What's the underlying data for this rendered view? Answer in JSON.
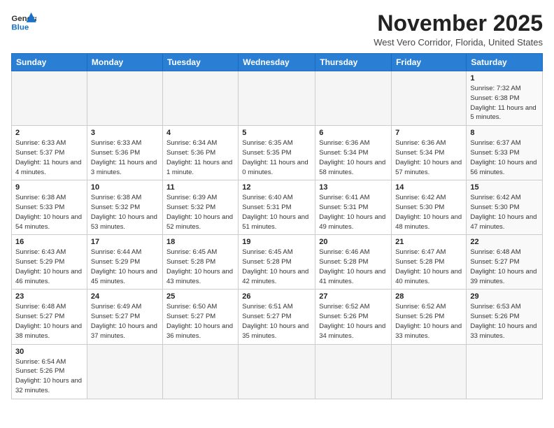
{
  "logo": {
    "line1": "General",
    "line2": "Blue"
  },
  "header": {
    "month": "November 2025",
    "location": "West Vero Corridor, Florida, United States"
  },
  "days_of_week": [
    "Sunday",
    "Monday",
    "Tuesday",
    "Wednesday",
    "Thursday",
    "Friday",
    "Saturday"
  ],
  "weeks": [
    [
      {
        "day": "",
        "info": ""
      },
      {
        "day": "",
        "info": ""
      },
      {
        "day": "",
        "info": ""
      },
      {
        "day": "",
        "info": ""
      },
      {
        "day": "",
        "info": ""
      },
      {
        "day": "",
        "info": ""
      },
      {
        "day": "1",
        "info": "Sunrise: 7:32 AM\nSunset: 6:38 PM\nDaylight: 11 hours and 5 minutes."
      }
    ],
    [
      {
        "day": "2",
        "info": "Sunrise: 6:33 AM\nSunset: 5:37 PM\nDaylight: 11 hours and 4 minutes."
      },
      {
        "day": "3",
        "info": "Sunrise: 6:33 AM\nSunset: 5:36 PM\nDaylight: 11 hours and 3 minutes."
      },
      {
        "day": "4",
        "info": "Sunrise: 6:34 AM\nSunset: 5:36 PM\nDaylight: 11 hours and 1 minute."
      },
      {
        "day": "5",
        "info": "Sunrise: 6:35 AM\nSunset: 5:35 PM\nDaylight: 11 hours and 0 minutes."
      },
      {
        "day": "6",
        "info": "Sunrise: 6:36 AM\nSunset: 5:34 PM\nDaylight: 10 hours and 58 minutes."
      },
      {
        "day": "7",
        "info": "Sunrise: 6:36 AM\nSunset: 5:34 PM\nDaylight: 10 hours and 57 minutes."
      },
      {
        "day": "8",
        "info": "Sunrise: 6:37 AM\nSunset: 5:33 PM\nDaylight: 10 hours and 56 minutes."
      }
    ],
    [
      {
        "day": "9",
        "info": "Sunrise: 6:38 AM\nSunset: 5:33 PM\nDaylight: 10 hours and 54 minutes."
      },
      {
        "day": "10",
        "info": "Sunrise: 6:38 AM\nSunset: 5:32 PM\nDaylight: 10 hours and 53 minutes."
      },
      {
        "day": "11",
        "info": "Sunrise: 6:39 AM\nSunset: 5:32 PM\nDaylight: 10 hours and 52 minutes."
      },
      {
        "day": "12",
        "info": "Sunrise: 6:40 AM\nSunset: 5:31 PM\nDaylight: 10 hours and 51 minutes."
      },
      {
        "day": "13",
        "info": "Sunrise: 6:41 AM\nSunset: 5:31 PM\nDaylight: 10 hours and 49 minutes."
      },
      {
        "day": "14",
        "info": "Sunrise: 6:42 AM\nSunset: 5:30 PM\nDaylight: 10 hours and 48 minutes."
      },
      {
        "day": "15",
        "info": "Sunrise: 6:42 AM\nSunset: 5:30 PM\nDaylight: 10 hours and 47 minutes."
      }
    ],
    [
      {
        "day": "16",
        "info": "Sunrise: 6:43 AM\nSunset: 5:29 PM\nDaylight: 10 hours and 46 minutes."
      },
      {
        "day": "17",
        "info": "Sunrise: 6:44 AM\nSunset: 5:29 PM\nDaylight: 10 hours and 45 minutes."
      },
      {
        "day": "18",
        "info": "Sunrise: 6:45 AM\nSunset: 5:28 PM\nDaylight: 10 hours and 43 minutes."
      },
      {
        "day": "19",
        "info": "Sunrise: 6:45 AM\nSunset: 5:28 PM\nDaylight: 10 hours and 42 minutes."
      },
      {
        "day": "20",
        "info": "Sunrise: 6:46 AM\nSunset: 5:28 PM\nDaylight: 10 hours and 41 minutes."
      },
      {
        "day": "21",
        "info": "Sunrise: 6:47 AM\nSunset: 5:28 PM\nDaylight: 10 hours and 40 minutes."
      },
      {
        "day": "22",
        "info": "Sunrise: 6:48 AM\nSunset: 5:27 PM\nDaylight: 10 hours and 39 minutes."
      }
    ],
    [
      {
        "day": "23",
        "info": "Sunrise: 6:48 AM\nSunset: 5:27 PM\nDaylight: 10 hours and 38 minutes."
      },
      {
        "day": "24",
        "info": "Sunrise: 6:49 AM\nSunset: 5:27 PM\nDaylight: 10 hours and 37 minutes."
      },
      {
        "day": "25",
        "info": "Sunrise: 6:50 AM\nSunset: 5:27 PM\nDaylight: 10 hours and 36 minutes."
      },
      {
        "day": "26",
        "info": "Sunrise: 6:51 AM\nSunset: 5:27 PM\nDaylight: 10 hours and 35 minutes."
      },
      {
        "day": "27",
        "info": "Sunrise: 6:52 AM\nSunset: 5:26 PM\nDaylight: 10 hours and 34 minutes."
      },
      {
        "day": "28",
        "info": "Sunrise: 6:52 AM\nSunset: 5:26 PM\nDaylight: 10 hours and 33 minutes."
      },
      {
        "day": "29",
        "info": "Sunrise: 6:53 AM\nSunset: 5:26 PM\nDaylight: 10 hours and 33 minutes."
      }
    ],
    [
      {
        "day": "30",
        "info": "Sunrise: 6:54 AM\nSunset: 5:26 PM\nDaylight: 10 hours and 32 minutes."
      },
      {
        "day": "",
        "info": ""
      },
      {
        "day": "",
        "info": ""
      },
      {
        "day": "",
        "info": ""
      },
      {
        "day": "",
        "info": ""
      },
      {
        "day": "",
        "info": ""
      },
      {
        "day": "",
        "info": ""
      }
    ]
  ]
}
